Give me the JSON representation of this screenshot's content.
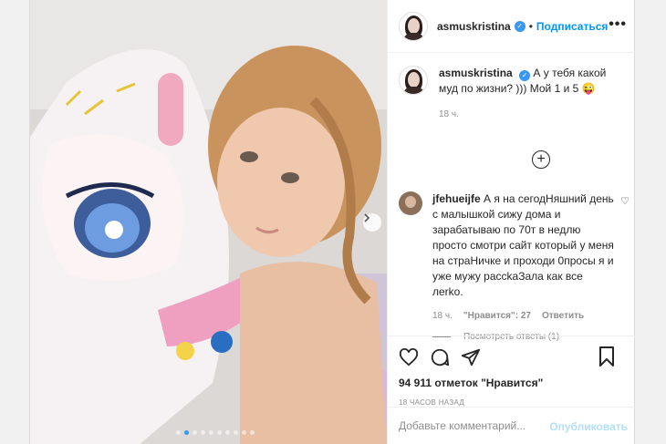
{
  "header": {
    "username": "asmuskristina",
    "separator": "•",
    "follow_label": "Подписаться",
    "more_label": "•••"
  },
  "caption": {
    "username": "asmuskristina",
    "text": "А у тебя какой муд по жизни? ))) Мой 1 и 5 😜",
    "time": "18 ч."
  },
  "load_more_label": "+",
  "comment": {
    "username": "jfehueijfe",
    "text": "А я на сегодНяшний день с малышкой сижу дома и зарабатываю по 70т в недлю просто смотри сайт который у меня на страНичке и проходи 0пpосы я и уже мужу рассkaЗала как все лerko.",
    "time": "18 ч.",
    "likes": "\"Нравится\": 27",
    "reply_label": "Ответить",
    "view_replies": "Посмотреть ответы (1)"
  },
  "actions": {
    "icons": [
      "heart-icon",
      "comment-icon",
      "share-icon",
      "bookmark-icon"
    ]
  },
  "likes_label": "94 911 отметок \"Нравится\"",
  "time_ago": "18 ЧАСОВ НАЗАД",
  "comment_input": {
    "placeholder": "Добавьте комментарий...",
    "publish_label": "Опубликовать"
  },
  "carousel": {
    "total_slides": 10,
    "active_index": 1
  },
  "colors": {
    "accent": "#0095f6",
    "publish_disabled": "#b2dffc",
    "verified": "#3897f0"
  }
}
